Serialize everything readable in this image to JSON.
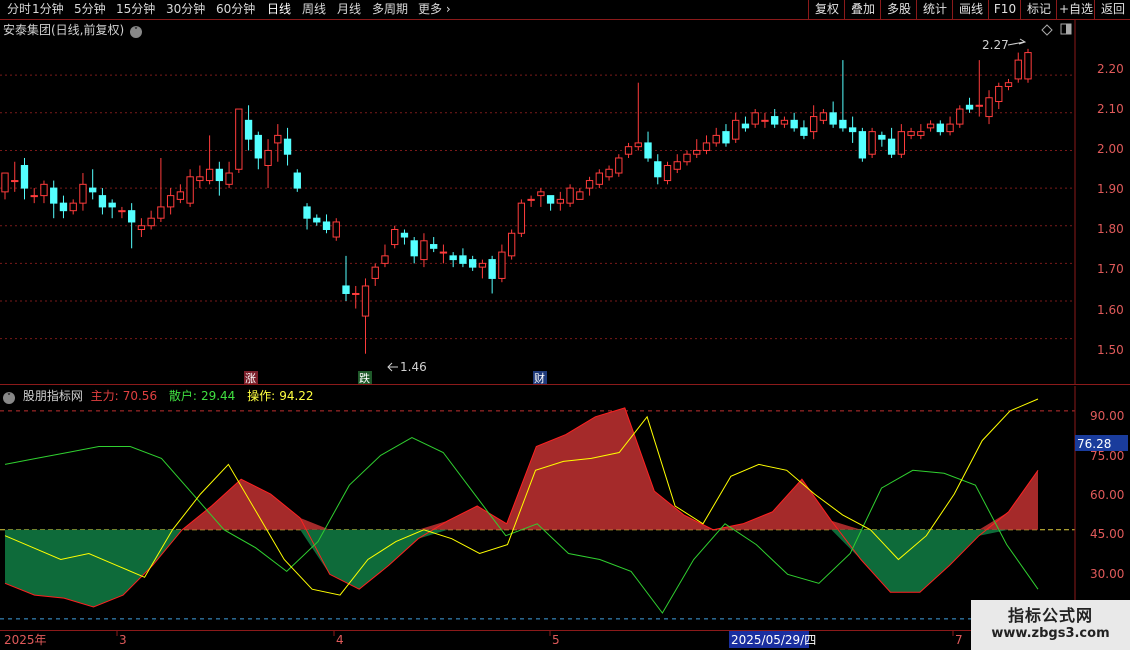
{
  "toolbar": {
    "periods": [
      "分时",
      "1分钟",
      "5分钟",
      "15分钟",
      "30分钟",
      "60分钟",
      "日线",
      "周线",
      "月线",
      "多周期",
      "更多"
    ],
    "active_period": "日线",
    "buttons": [
      "复权",
      "叠加",
      "多股",
      "统计",
      "画线",
      "F10",
      "+自选",
      "返回"
    ]
  },
  "stock_title": "安泰集团(日线,前复权)",
  "main_axis": {
    "labels": [
      "2.20",
      "2.10",
      "2.00",
      "1.90",
      "1.80",
      "1.70",
      "1.60",
      "1.50"
    ]
  },
  "markers": {
    "high_label": "2.27",
    "low_label": "1.46",
    "rise": "涨",
    "fall": "跌",
    "report": "财"
  },
  "indicator": {
    "name": "股朋指标网",
    "zhuli_label": "主力:",
    "zhuli_value": "70.56",
    "sanhu_label": "散户:",
    "sanhu_value": "29.44",
    "caozuo_label": "操作:",
    "caozuo_value": "94.22",
    "axis_labels": [
      "90.00",
      "75.00",
      "60.00",
      "45.00",
      "30.00"
    ],
    "current_value": "76.28"
  },
  "date_axis": {
    "labels": [
      "2025年",
      "3",
      "4",
      "5",
      "2025/05/29/四",
      "7"
    ]
  },
  "watermark": {
    "line1": "指标公式网",
    "line2": "www.zbgs3.com"
  },
  "colors": {
    "up": "#ff3c3c",
    "down": "#54ffff",
    "zhuli": "#a52a2a",
    "sanhu": "#0e6b3a",
    "caozuo": "#ffff00"
  },
  "chart_data": {
    "type": "candlestick",
    "y_range": [
      1.43,
      2.32
    ],
    "candles": [
      [
        1.89,
        1.94,
        1.93,
        1.87
      ],
      [
        1.92,
        1.92,
        1.97,
        1.89
      ],
      [
        1.96,
        1.9,
        1.98,
        1.87
      ],
      [
        1.88,
        1.88,
        1.9,
        1.86
      ],
      [
        1.88,
        1.91,
        1.92,
        1.86
      ],
      [
        1.9,
        1.86,
        1.92,
        1.82
      ],
      [
        1.86,
        1.84,
        1.88,
        1.82
      ],
      [
        1.84,
        1.86,
        1.87,
        1.83
      ],
      [
        1.86,
        1.91,
        1.94,
        1.84
      ],
      [
        1.9,
        1.89,
        1.95,
        1.87
      ],
      [
        1.88,
        1.85,
        1.9,
        1.83
      ],
      [
        1.86,
        1.85,
        1.87,
        1.82
      ],
      [
        1.84,
        1.84,
        1.85,
        1.82
      ],
      [
        1.84,
        1.81,
        1.86,
        1.74
      ],
      [
        1.79,
        1.8,
        1.82,
        1.77
      ],
      [
        1.8,
        1.82,
        1.84,
        1.79
      ],
      [
        1.82,
        1.85,
        1.98,
        1.81
      ],
      [
        1.85,
        1.88,
        1.9,
        1.83
      ],
      [
        1.87,
        1.89,
        1.91,
        1.86
      ],
      [
        1.86,
        1.93,
        1.95,
        1.85
      ],
      [
        1.92,
        1.93,
        1.96,
        1.9
      ],
      [
        1.92,
        1.95,
        2.04,
        1.91
      ],
      [
        1.95,
        1.92,
        1.97,
        1.88
      ],
      [
        1.91,
        1.94,
        1.97,
        1.9
      ],
      [
        1.95,
        2.11,
        2.11,
        1.94
      ],
      [
        2.08,
        2.03,
        2.12,
        2.0
      ],
      [
        2.04,
        1.98,
        2.05,
        1.95
      ],
      [
        1.96,
        2.0,
        2.03,
        1.9
      ],
      [
        2.02,
        2.04,
        2.07,
        1.97
      ],
      [
        2.03,
        1.99,
        2.06,
        1.96
      ],
      [
        1.94,
        1.9,
        1.95,
        1.89
      ],
      [
        1.85,
        1.82,
        1.86,
        1.79
      ],
      [
        1.82,
        1.81,
        1.83,
        1.8
      ],
      [
        1.81,
        1.79,
        1.83,
        1.78
      ],
      [
        1.77,
        1.81,
        1.82,
        1.76
      ],
      [
        1.64,
        1.62,
        1.72,
        1.6
      ],
      [
        1.62,
        1.62,
        1.64,
        1.58
      ],
      [
        1.56,
        1.64,
        1.66,
        1.46
      ],
      [
        1.66,
        1.69,
        1.7,
        1.64
      ],
      [
        1.7,
        1.72,
        1.75,
        1.69
      ],
      [
        1.75,
        1.79,
        1.8,
        1.74
      ],
      [
        1.78,
        1.77,
        1.79,
        1.75
      ],
      [
        1.76,
        1.72,
        1.77,
        1.7
      ],
      [
        1.71,
        1.76,
        1.78,
        1.69
      ],
      [
        1.75,
        1.74,
        1.77,
        1.73
      ],
      [
        1.73,
        1.73,
        1.75,
        1.7
      ],
      [
        1.72,
        1.71,
        1.73,
        1.69
      ],
      [
        1.72,
        1.7,
        1.74,
        1.69
      ],
      [
        1.71,
        1.69,
        1.72,
        1.68
      ],
      [
        1.69,
        1.7,
        1.71,
        1.66
      ],
      [
        1.71,
        1.66,
        1.72,
        1.62
      ],
      [
        1.66,
        1.73,
        1.75,
        1.65
      ],
      [
        1.72,
        1.78,
        1.79,
        1.71
      ],
      [
        1.78,
        1.86,
        1.87,
        1.77
      ],
      [
        1.87,
        1.87,
        1.88,
        1.85
      ],
      [
        1.88,
        1.89,
        1.9,
        1.85
      ],
      [
        1.88,
        1.86,
        1.88,
        1.84
      ],
      [
        1.86,
        1.87,
        1.89,
        1.84
      ],
      [
        1.86,
        1.9,
        1.91,
        1.85
      ],
      [
        1.87,
        1.89,
        1.9,
        1.87
      ],
      [
        1.9,
        1.92,
        1.93,
        1.88
      ],
      [
        1.91,
        1.94,
        1.95,
        1.9
      ],
      [
        1.93,
        1.95,
        1.96,
        1.92
      ],
      [
        1.94,
        1.98,
        1.99,
        1.93
      ],
      [
        1.99,
        2.01,
        2.02,
        1.98
      ],
      [
        2.01,
        2.02,
        2.18,
        2.0
      ],
      [
        2.02,
        1.98,
        2.05,
        1.97
      ],
      [
        1.97,
        1.93,
        1.99,
        1.91
      ],
      [
        1.92,
        1.96,
        1.97,
        1.91
      ],
      [
        1.95,
        1.97,
        1.99,
        1.94
      ],
      [
        1.97,
        1.99,
        2.0,
        1.96
      ],
      [
        1.99,
        2.0,
        2.03,
        1.98
      ],
      [
        2.0,
        2.02,
        2.04,
        1.99
      ],
      [
        2.02,
        2.04,
        2.06,
        2.01
      ],
      [
        2.05,
        2.02,
        2.07,
        2.01
      ],
      [
        2.03,
        2.08,
        2.1,
        2.02
      ],
      [
        2.07,
        2.06,
        2.09,
        2.05
      ],
      [
        2.07,
        2.1,
        2.11,
        2.06
      ],
      [
        2.08,
        2.08,
        2.1,
        2.06
      ],
      [
        2.09,
        2.07,
        2.11,
        2.06
      ],
      [
        2.07,
        2.08,
        2.09,
        2.06
      ],
      [
        2.08,
        2.06,
        2.1,
        2.05
      ],
      [
        2.06,
        2.04,
        2.08,
        2.03
      ],
      [
        2.05,
        2.09,
        2.12,
        2.03
      ],
      [
        2.08,
        2.1,
        2.11,
        2.07
      ],
      [
        2.1,
        2.07,
        2.13,
        2.06
      ],
      [
        2.08,
        2.06,
        2.24,
        2.05
      ],
      [
        2.06,
        2.05,
        2.09,
        2.02
      ],
      [
        2.05,
        1.98,
        2.06,
        1.97
      ],
      [
        1.99,
        2.05,
        2.06,
        1.98
      ],
      [
        2.04,
        2.03,
        2.05,
        2.01
      ],
      [
        2.03,
        1.99,
        2.06,
        1.98
      ],
      [
        1.99,
        2.05,
        2.07,
        1.98
      ],
      [
        2.04,
        2.05,
        2.06,
        2.03
      ],
      [
        2.04,
        2.05,
        2.07,
        2.03
      ],
      [
        2.06,
        2.07,
        2.08,
        2.05
      ],
      [
        2.07,
        2.05,
        2.08,
        2.04
      ],
      [
        2.05,
        2.07,
        2.09,
        2.04
      ],
      [
        2.07,
        2.11,
        2.12,
        2.06
      ],
      [
        2.12,
        2.11,
        2.14,
        2.1
      ],
      [
        2.12,
        2.12,
        2.24,
        2.09
      ],
      [
        2.09,
        2.14,
        2.16,
        2.07
      ],
      [
        2.13,
        2.17,
        2.18,
        2.11
      ],
      [
        2.17,
        2.18,
        2.19,
        2.16
      ],
      [
        2.19,
        2.24,
        2.26,
        2.18
      ],
      [
        2.19,
        2.26,
        2.27,
        2.18
      ]
    ],
    "indicator_series": {
      "y_range": [
        23,
        95
      ],
      "x": [
        0,
        0.04,
        0.08,
        0.12,
        0.16,
        0.19,
        0.22,
        0.26,
        0.3,
        0.33,
        0.36,
        0.39,
        0.42,
        0.45,
        0.48,
        0.5,
        0.53,
        0.56,
        0.6,
        0.62,
        0.65,
        0.68,
        0.72,
        0.75,
        0.78,
        0.81,
        0.84,
        0.87,
        0.9,
        0.93,
        0.96,
        1.0
      ],
      "zhuli": [
        32,
        28,
        27,
        24,
        28,
        38,
        50,
        58,
        67,
        62,
        54,
        35,
        30,
        38,
        47,
        53,
        58,
        52,
        78,
        82,
        88,
        91,
        63,
        55,
        50,
        52,
        56,
        67,
        53,
        40,
        29,
        29,
        38,
        48,
        56,
        70
      ],
      "sanhu": [
        72,
        74,
        76,
        78,
        78,
        74,
        62,
        50,
        44,
        36,
        46,
        65,
        75,
        81,
        76,
        62,
        48,
        52,
        42,
        40,
        36,
        22,
        40,
        52,
        45,
        35,
        32,
        42,
        64,
        70,
        69,
        65,
        45,
        30
      ],
      "caozuo": [
        48,
        44,
        40,
        42,
        38,
        34,
        50,
        62,
        72,
        56,
        40,
        30,
        28,
        40,
        46,
        50,
        47,
        42,
        45,
        70,
        73,
        74,
        76,
        88,
        58,
        52,
        68,
        72,
        70,
        62,
        55,
        50,
        40,
        48,
        62,
        80,
        90,
        94
      ]
    }
  }
}
